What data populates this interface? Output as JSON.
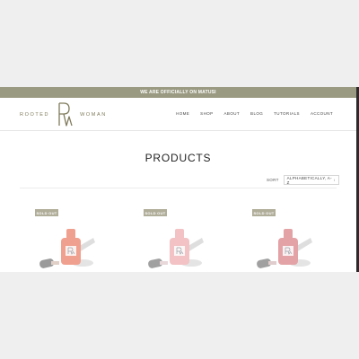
{
  "announcement": "WE ARE OFFICIALLY ON MATUSI",
  "brand": {
    "left_word": "ROOTED",
    "right_word": "WOMAN"
  },
  "nav": [
    "HOME",
    "SHOP",
    "ABOUT",
    "BLOG",
    "TUTORIALS",
    "ACCOUNT"
  ],
  "page_title": "PRODUCTS",
  "sort": {
    "label": "SORT",
    "value": "ALPHABETICALLY, A-Z"
  },
  "products": [
    {
      "badge": "SOLD OUT",
      "color": "#f0a08f"
    },
    {
      "badge": "SOLD OUT",
      "color": "#f2c2c4"
    },
    {
      "badge": "SOLD OUT",
      "color": "#e3a3a6"
    }
  ],
  "colors": {
    "accent": "#9a9a82",
    "badge": "#b0ad99",
    "brand": "#7f7a5a"
  }
}
